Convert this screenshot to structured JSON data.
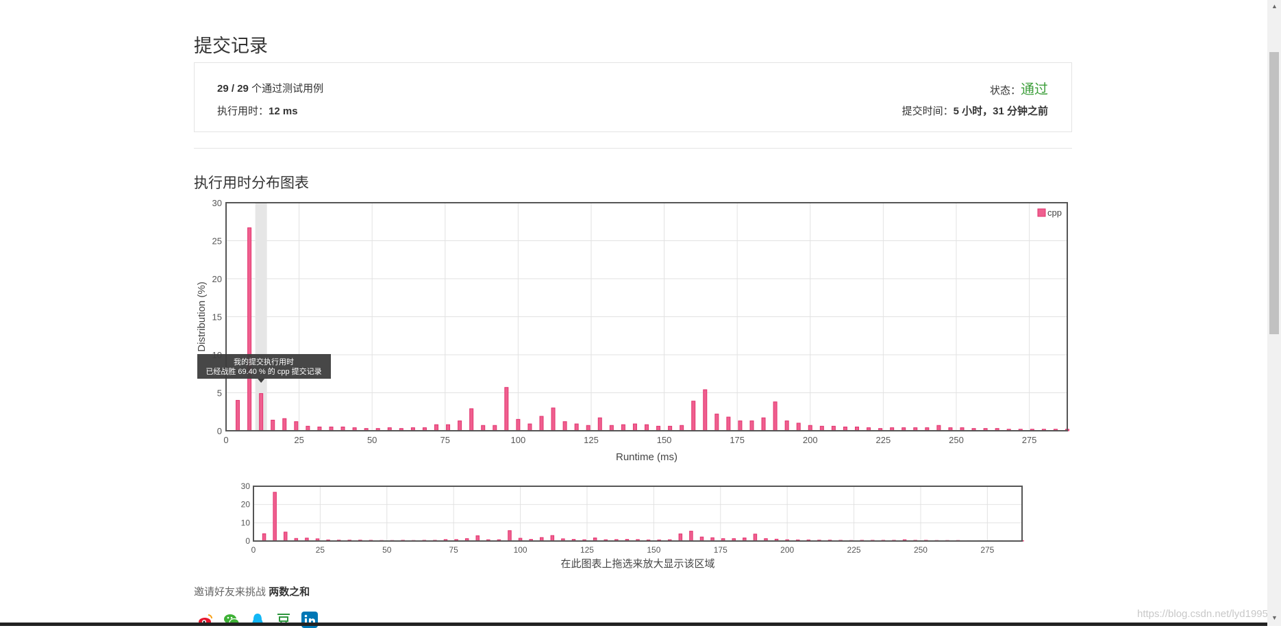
{
  "page": {
    "title": "提交记录"
  },
  "summary": {
    "passed": "29",
    "slash": "/",
    "total": "29",
    "passed_label": "个通过测试用例",
    "runtime_label": "执行用时：",
    "runtime_value": "12 ms",
    "status_label": "状态：",
    "status_value": "通过",
    "submit_label": "提交时间：",
    "submit_value": "5 小时，31 分钟之前"
  },
  "chart_section": {
    "title": "执行用时分布图表"
  },
  "tooltip": {
    "line1": "我的提交执行用时",
    "line2": "已经战胜 69.40 % 的 cpp 提交记录"
  },
  "navigator": {
    "caption": "在此图表上拖选来放大显示该区域"
  },
  "invite": {
    "text": "邀请好友来挑战",
    "problem": "两数之和"
  },
  "share_icons": [
    "weibo-icon",
    "wechat-icon",
    "qq-icon",
    "douban-icon",
    "linkedin-icon"
  ],
  "watermark": "https://blog.csdn.net/lyd1995",
  "colors": {
    "bar": "#ef5f8f",
    "bar_stroke": "#e2336e",
    "status": "#3c9e3a",
    "highlight": "#e6e6e6"
  },
  "chart_data": {
    "type": "bar",
    "xlabel": "Runtime (ms)",
    "ylabel": "Distribution (%)",
    "xlim": [
      0,
      288
    ],
    "ylim": [
      0,
      30
    ],
    "xticks": [
      0,
      25,
      50,
      75,
      100,
      125,
      150,
      175,
      200,
      225,
      250,
      275
    ],
    "yticks": [
      0,
      5,
      10,
      15,
      20,
      25,
      30
    ],
    "legend": {
      "label": "cpp",
      "position": "top-right"
    },
    "highlight_x": 12,
    "grid": true,
    "series": [
      {
        "name": "cpp",
        "x": [
          4,
          8,
          12,
          16,
          20,
          24,
          28,
          32,
          36,
          40,
          44,
          48,
          52,
          56,
          60,
          64,
          68,
          72,
          76,
          80,
          84,
          88,
          92,
          96,
          100,
          104,
          108,
          112,
          116,
          120,
          124,
          128,
          132,
          136,
          140,
          144,
          148,
          152,
          156,
          160,
          164,
          168,
          172,
          176,
          180,
          184,
          188,
          192,
          196,
          200,
          204,
          208,
          212,
          216,
          220,
          224,
          228,
          232,
          236,
          240,
          244,
          248,
          252,
          256,
          260,
          264,
          268,
          272,
          276,
          280,
          284,
          288
        ],
        "values": [
          4.0,
          26.7,
          4.9,
          1.4,
          1.6,
          1.2,
          0.6,
          0.5,
          0.5,
          0.5,
          0.4,
          0.3,
          0.3,
          0.4,
          0.3,
          0.4,
          0.4,
          0.8,
          0.8,
          1.3,
          2.9,
          0.7,
          0.7,
          5.7,
          1.5,
          0.9,
          1.9,
          3.0,
          1.2,
          0.9,
          0.7,
          1.7,
          0.7,
          0.8,
          0.9,
          0.8,
          0.6,
          0.6,
          0.7,
          3.9,
          5.4,
          2.2,
          1.8,
          1.3,
          1.3,
          1.7,
          3.8,
          1.3,
          1.0,
          0.7,
          0.6,
          0.6,
          0.5,
          0.5,
          0.4,
          0.3,
          0.4,
          0.4,
          0.4,
          0.4,
          0.7,
          0.4,
          0.4,
          0.3,
          0.3,
          0.3,
          0.2,
          0.2,
          0.2,
          0.2,
          0.2,
          0.2
        ]
      }
    ]
  },
  "nav_chart_data": {
    "type": "bar",
    "xlim": [
      0,
      288
    ],
    "ylim": [
      0,
      30
    ],
    "xticks": [
      0,
      25,
      50,
      75,
      100,
      125,
      150,
      175,
      200,
      225,
      250,
      275
    ],
    "yticks": [
      0,
      10,
      20,
      30
    ]
  }
}
